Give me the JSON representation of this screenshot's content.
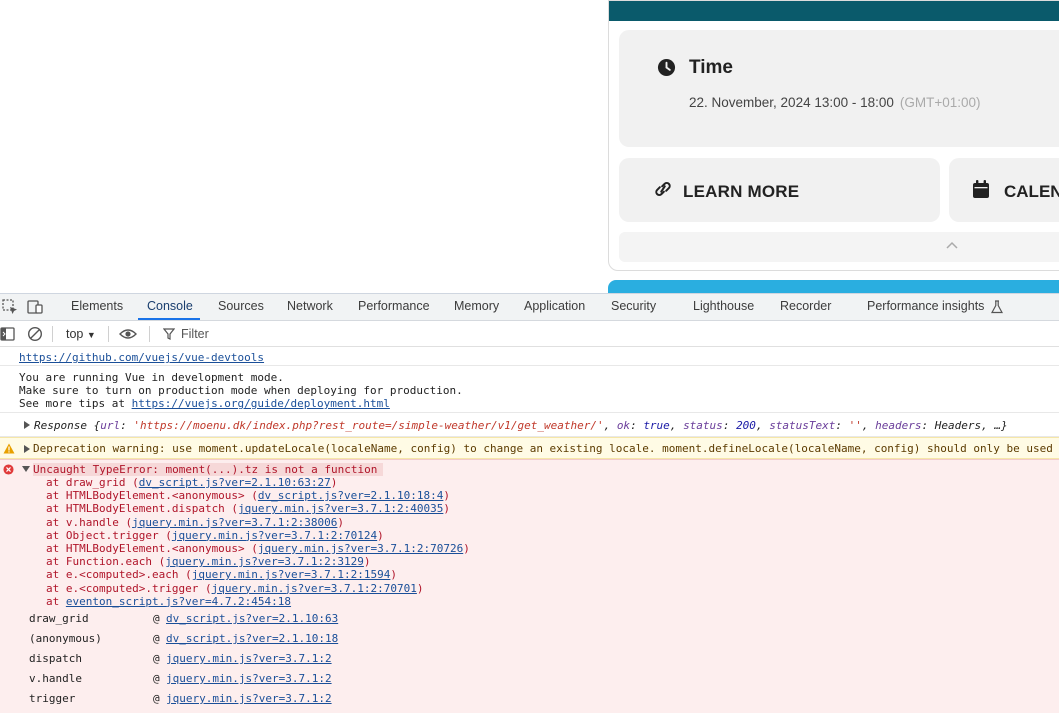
{
  "event": {
    "time_title": "Time",
    "time_value": "22. November, 2024 13:00 - 18:00",
    "time_tz": "(GMT+01:00)",
    "learn_more_label": "LEARN MORE",
    "calendar_label": "CALENI",
    "icons": [
      "clock-icon",
      "link-icon",
      "calendar-icon",
      "chevron-up-icon"
    ],
    "colors": {
      "header_bar": "#0a5a6b",
      "next_card_bar": "#2aaee0"
    }
  },
  "devtools": {
    "tabs": [
      "Elements",
      "Console",
      "Sources",
      "Network",
      "Performance",
      "Memory",
      "Application",
      "Security",
      "Lighthouse",
      "Recorder",
      "Performance insights"
    ],
    "active_tab": "Console",
    "context": "top",
    "filter_placeholder": "Filter",
    "accent_color": "#1a73e8"
  },
  "console": {
    "vue1_link": "https://github.com/vuejs/vue-devtools",
    "vue2_line1": "You are running Vue in development mode.",
    "vue2_line2": "Make sure to turn on production mode when deploying for production.",
    "vue2_line3_prefix": "See more tips at",
    "vue2_link": "https://vuejs.org/guide/deployment.html",
    "response": {
      "prefix": "Response {",
      "url_key": "url",
      "url_value": "'https://moenu.dk/index.php?rest_route=/simple-weather/v1/get_weather/'",
      "ok_key": "ok",
      "ok_value": "true",
      "status_key": "status",
      "status_value": "200",
      "statustext_key": "statusText",
      "statustext_value": "''",
      "headers_key": "headers",
      "headers_value": "Headers, …}"
    },
    "warning": "Deprecation warning: use moment.updateLocale(localeName, config) to change an existing locale. moment.defineLocale(localeName, config) should only be used",
    "error_title": "Uncaught TypeError: moment(...).tz is not a function",
    "stack": [
      {
        "prefix": "at draw_grid (",
        "link": "dv_script.js?ver=2.1.10:63:27",
        "suffix": ")"
      },
      {
        "prefix": "at HTMLBodyElement.<anonymous> (",
        "link": "dv_script.js?ver=2.1.10:18:4",
        "suffix": ")"
      },
      {
        "prefix": "at HTMLBodyElement.dispatch (",
        "link": "jquery.min.js?ver=3.7.1:2:40035",
        "suffix": ")"
      },
      {
        "prefix": "at v.handle (",
        "link": "jquery.min.js?ver=3.7.1:2:38006",
        "suffix": ")"
      },
      {
        "prefix": "at Object.trigger (",
        "link": "jquery.min.js?ver=3.7.1:2:70124",
        "suffix": ")"
      },
      {
        "prefix": "at HTMLBodyElement.<anonymous> (",
        "link": "jquery.min.js?ver=3.7.1:2:70726",
        "suffix": ")"
      },
      {
        "prefix": "at Function.each (",
        "link": "jquery.min.js?ver=3.7.1:2:3129",
        "suffix": ")"
      },
      {
        "prefix": "at e.<computed>.each (",
        "link": "jquery.min.js?ver=3.7.1:2:1594",
        "suffix": ")"
      },
      {
        "prefix": "at e.<computed>.trigger (",
        "link": "jquery.min.js?ver=3.7.1:2:70701",
        "suffix": ")"
      },
      {
        "prefix": "at ",
        "link": "eventon_script.js?ver=4.7.2:454:18",
        "suffix": ""
      }
    ],
    "call_frames": [
      {
        "fn": "draw_grid",
        "at": "@",
        "link": "dv_script.js?ver=2.1.10:63"
      },
      {
        "fn": "(anonymous)",
        "at": "@",
        "link": "dv_script.js?ver=2.1.10:18"
      },
      {
        "fn": "dispatch",
        "at": "@",
        "link": "jquery.min.js?ver=3.7.1:2"
      },
      {
        "fn": "v.handle",
        "at": "@",
        "link": "jquery.min.js?ver=3.7.1:2"
      },
      {
        "fn": "trigger",
        "at": "@",
        "link": "jquery.min.js?ver=3.7.1:2"
      }
    ]
  }
}
